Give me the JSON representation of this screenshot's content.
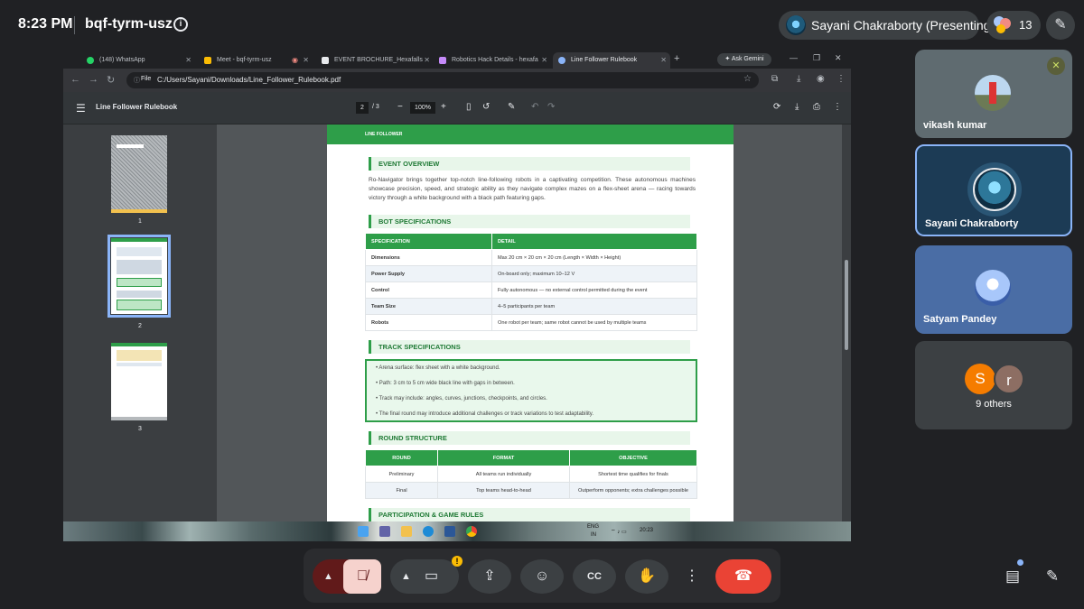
{
  "meet": {
    "time": "8:23 PM",
    "meeting_code": "bqf-tyrm-usz",
    "info_icon": "info-icon",
    "presenter_label": "Sayani Chakraborty (Presenting)",
    "participant_count": "13",
    "host_controls_icon": "pen-icon"
  },
  "browser": {
    "tabs": [
      {
        "label": "(148) WhatsApp",
        "icon": "whatsapp-icon",
        "color": "#25d366"
      },
      {
        "label": "Meet - bqf-tyrm-usz",
        "icon": "meet-icon",
        "color": "#fbbc04"
      },
      {
        "label": "EVENT BROCHURE_Hexafalls",
        "icon": "doc-icon",
        "color": "#e8eaed"
      },
      {
        "label": "Robotics Hack Details - hexafa",
        "icon": "doc-icon",
        "color": "#c58af9"
      },
      {
        "label": "Line Follower Rulebook",
        "icon": "globe-icon",
        "color": "#8ab4f8"
      }
    ],
    "new_tab": "+",
    "gemini_label": "Ask Gemini",
    "file_label": "File",
    "url": "C:/Users/Sayani/Downloads/Line_Follower_Rulebook.pdf"
  },
  "pdf": {
    "title": "Line Follower Rulebook",
    "current_page": "2",
    "total_pages": "/ 3",
    "zoom": "100%",
    "zoom_out": "−",
    "zoom_in": "+",
    "thumbnails": [
      {
        "num": "1"
      },
      {
        "num": "2"
      },
      {
        "num": "3"
      }
    ]
  },
  "doc": {
    "header": "LINE FOLLOWER",
    "event_overview_h": "EVENT OVERVIEW",
    "event_overview_text": "Ro-Navigator brings together top-notch line-following robots in a captivating competition. These autonomous machines showcase precision, speed, and strategic ability as they navigate complex mazes on a flex-sheet arena — racing towards victory through a white background with a black path featuring gaps.",
    "bot_spec_h": "BOT SPECIFICATIONS",
    "bot_spec_cols": [
      "SPECIFICATION",
      "DETAIL"
    ],
    "bot_spec_rows": [
      [
        "Dimensions",
        "Max 20 cm × 20 cm × 20 cm (Length × Width × Height)"
      ],
      [
        "Power Supply",
        "On-board only; maximum 10–12 V"
      ],
      [
        "Control",
        "Fully autonomous — no external control permitted during the event"
      ],
      [
        "Team Size",
        "4–5 participants per team"
      ],
      [
        "Robots",
        "One robot per team; same robot cannot be used by multiple teams"
      ]
    ],
    "track_spec_h": "TRACK SPECIFICATIONS",
    "track_items": [
      "• Arena surface: flex sheet with a white background.",
      "• Path: 3 cm to 5 cm wide black line with gaps in between.",
      "• Track may include: angles, curves, junctions, checkpoints, and circles.",
      "• The final round may introduce additional challenges or track variations to test adaptability."
    ],
    "round_h": "ROUND STRUCTURE",
    "round_cols": [
      "ROUND",
      "FORMAT",
      "OBJECTIVE"
    ],
    "round_rows": [
      [
        "Preliminary",
        "All teams run individually",
        "Shortest time qualifies for finals"
      ],
      [
        "Final",
        "Top teams head-to-head",
        "Outperform opponents; extra challenges possible"
      ]
    ],
    "participation_h": "PARTICIPATION & GAME RULES"
  },
  "taskbar": {
    "lang": "ENG",
    "region": "IN",
    "clock": "20:23"
  },
  "participants": [
    {
      "name": "vikash kumar",
      "muted": true
    },
    {
      "name": "Sayani Chakraborty",
      "speaking": true
    },
    {
      "name": "Satyam Pandey"
    },
    {
      "name": "9 others",
      "avatars": [
        "S",
        "r"
      ]
    }
  ],
  "controls": {
    "mic_icon": "mic-off-icon",
    "camera_icon": "camera-icon",
    "present_icon": "present-icon",
    "emoji_icon": "emoji-icon",
    "captions_icon": "captions-icon",
    "hand_icon": "hand-icon",
    "more_icon": "more-icon",
    "end_icon": "end-call-icon",
    "chat_icon": "chat-icon",
    "activities_icon": "activities-icon",
    "accent_end": "#ea4335",
    "accent_mic": "#611a1a"
  }
}
